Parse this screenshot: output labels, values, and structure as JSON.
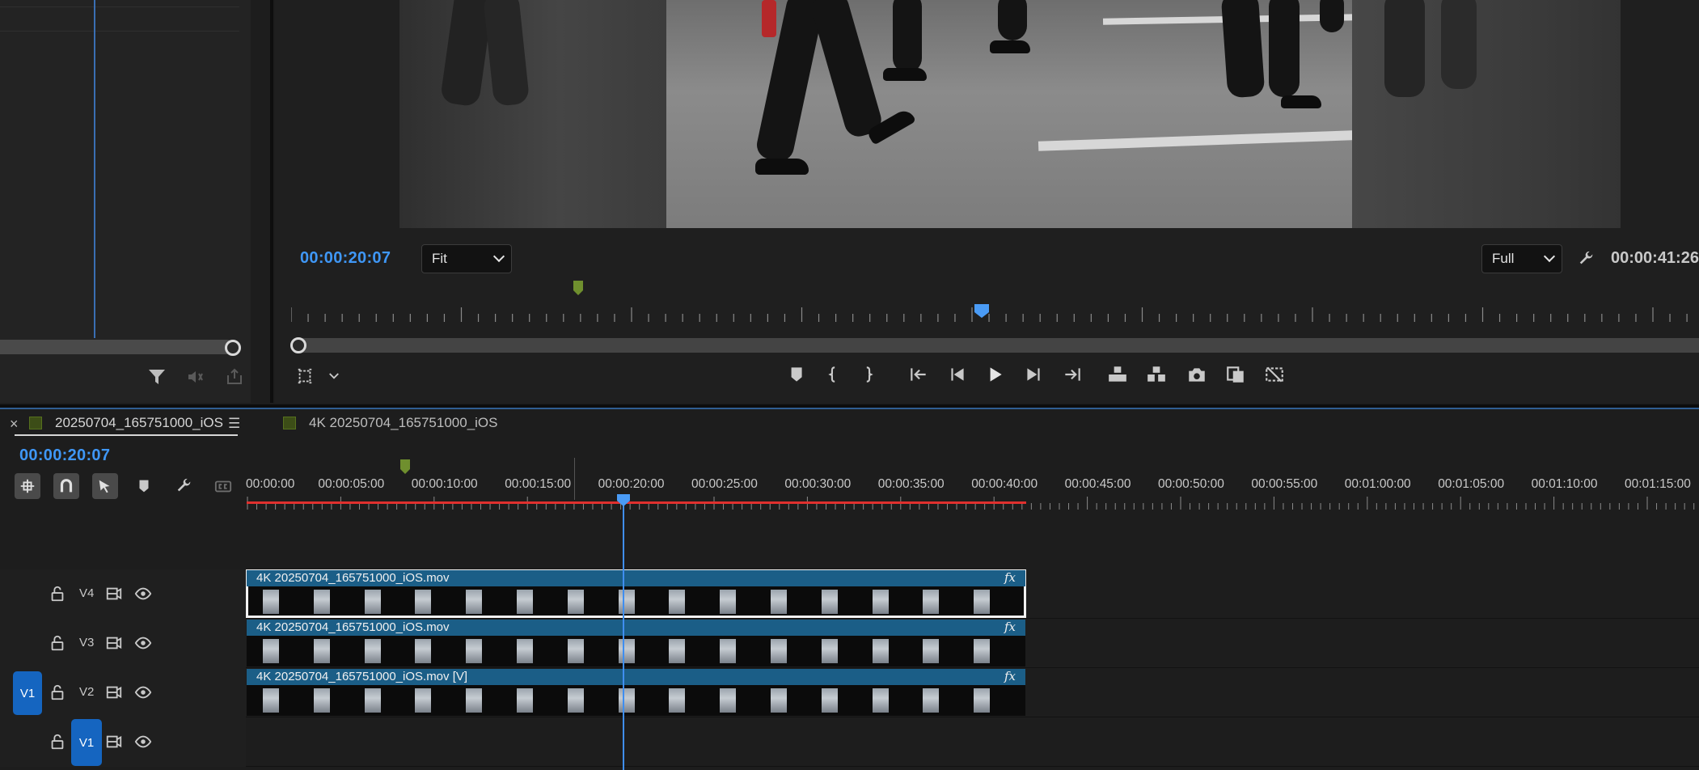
{
  "left_panel": {
    "icons": [
      "filter-icon",
      "audio-icon",
      "export-icon"
    ]
  },
  "program_monitor": {
    "current_timecode": "00:00:20:07",
    "zoom": "Fit",
    "resolution": "Full",
    "duration_timecode": "00:00:41:26",
    "controls": [
      {
        "name": "add-marker-button",
        "icon": "marker-icon"
      },
      {
        "name": "mark-in-button",
        "icon": "mark-in-icon"
      },
      {
        "name": "mark-out-button",
        "icon": "mark-out-icon"
      },
      {
        "name": "go-to-in-button",
        "icon": "go-to-in-icon"
      },
      {
        "name": "step-back-button",
        "icon": "step-back-icon"
      },
      {
        "name": "play-button",
        "icon": "play-icon"
      },
      {
        "name": "step-forward-button",
        "icon": "step-forward-icon"
      },
      {
        "name": "go-to-out-button",
        "icon": "go-to-out-icon"
      },
      {
        "name": "lift-button",
        "icon": "lift-icon"
      },
      {
        "name": "extract-button",
        "icon": "extract-icon"
      },
      {
        "name": "export-frame-button",
        "icon": "camera-icon"
      },
      {
        "name": "comparison-view-button",
        "icon": "comparison-icon"
      },
      {
        "name": "proxy-toggle-button",
        "icon": "proxy-icon"
      }
    ]
  },
  "timeline": {
    "tabs": [
      {
        "label": "20250704_165751000_iOS",
        "active": true
      },
      {
        "label": "4K 20250704_165751000_iOS",
        "active": false
      }
    ],
    "current_timecode": "00:00:20:07",
    "ruler_labels": [
      "00:00:00",
      "00:00:05:00",
      "00:00:10:00",
      "00:00:15:00",
      "00:00:20:00",
      "00:00:25:00",
      "00:00:30:00",
      "00:00:35:00",
      "00:00:40:00",
      "00:00:45:00",
      "00:00:50:00",
      "00:00:55:00",
      "00:01:00:00",
      "00:01:05:00",
      "00:01:10:00",
      "00:01:15:00"
    ],
    "tracks": [
      {
        "name": "V4",
        "clip": "4K 20250704_165751000_iOS.mov",
        "fx": "fx",
        "selected": true,
        "source_patch": ""
      },
      {
        "name": "V3",
        "clip": "4K 20250704_165751000_iOS.mov",
        "fx": "fx",
        "selected": false,
        "source_patch": ""
      },
      {
        "name": "V2",
        "clip": "4K 20250704_165751000_iOS.mov [V]",
        "fx": "fx",
        "selected": false,
        "source_patch": "V1"
      },
      {
        "name": "V1",
        "clip": "",
        "fx": "",
        "selected": false,
        "source_patch": ""
      }
    ],
    "active_track_label": "V1",
    "colors": {
      "accent": "#3f97f6",
      "clip": "#1b5e87",
      "render_bar": "#e0302e",
      "source_patch": "#1565c0"
    }
  }
}
